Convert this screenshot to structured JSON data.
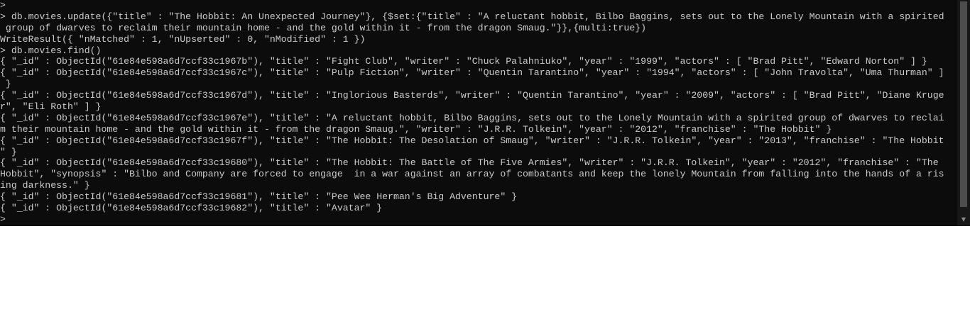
{
  "terminal": {
    "lines": [
      ">",
      "> db.movies.update({\"title\" : \"The Hobbit: An Unexpected Journey\"}, {$set:{\"title\" : \"A reluctant hobbit, Bilbo Baggins, sets out to the Lonely Mountain with a spirited",
      " group of dwarves to reclaim their mountain home - and the gold within it - from the dragon Smaug.\"}},{multi:true})",
      "WriteResult({ \"nMatched\" : 1, \"nUpserted\" : 0, \"nModified\" : 1 })",
      "> db.movies.find()",
      "{ \"_id\" : ObjectId(\"61e84e598a6d7ccf33c1967b\"), \"title\" : \"Fight Club\", \"writer\" : \"Chuck Palahniuko\", \"year\" : \"1999\", \"actors\" : [ \"Brad Pitt\", \"Edward Norton\" ] }",
      "{ \"_id\" : ObjectId(\"61e84e598a6d7ccf33c1967c\"), \"title\" : \"Pulp Fiction\", \"writer\" : \"Quentin Tarantino\", \"year\" : \"1994\", \"actors\" : [ \"John Travolta\", \"Uma Thurman\" ]",
      " }",
      "{ \"_id\" : ObjectId(\"61e84e598a6d7ccf33c1967d\"), \"title\" : \"Inglorious Basterds\", \"writer\" : \"Quentin Tarantino\", \"year\" : \"2009\", \"actors\" : [ \"Brad Pitt\", \"Diane Kruge",
      "r\", \"Eli Roth\" ] }",
      "{ \"_id\" : ObjectId(\"61e84e598a6d7ccf33c1967e\"), \"title\" : \"A reluctant hobbit, Bilbo Baggins, sets out to the Lonely Mountain with a spirited group of dwarves to reclai",
      "m their mountain home - and the gold within it - from the dragon Smaug.\", \"writer\" : \"J.R.R. Tolkein\", \"year\" : \"2012\", \"franchise\" : \"The Hobbit\" }",
      "{ \"_id\" : ObjectId(\"61e84e598a6d7ccf33c1967f\"), \"title\" : \"The Hobbit: The Desolation of Smaug\", \"writer\" : \"J.R.R. Tolkein\", \"year\" : \"2013\", \"franchise\" : \"The Hobbit",
      "\" }",
      "{ \"_id\" : ObjectId(\"61e84e598a6d7ccf33c19680\"), \"title\" : \"The Hobbit: The Battle of The Five Armies\", \"writer\" : \"J.R.R. Tolkein\", \"year\" : \"2012\", \"franchise\" : \"The",
      "Hobbit\", \"synopsis\" : \"Bilbo and Company are forced to engage  in a war against an array of combatants and keep the lonely Mountain from falling into the hands of a ris",
      "ing darkness.\" }",
      "{ \"_id\" : ObjectId(\"61e84e598a6d7ccf33c19681\"), \"title\" : \"Pee Wee Herman's Big Adventure\" }",
      "{ \"_id\" : ObjectId(\"61e84e598a6d7ccf33c19682\"), \"title\" : \"Avatar\" }",
      ">"
    ]
  },
  "scrollbar": {
    "down_arrow_icon": "▼"
  }
}
